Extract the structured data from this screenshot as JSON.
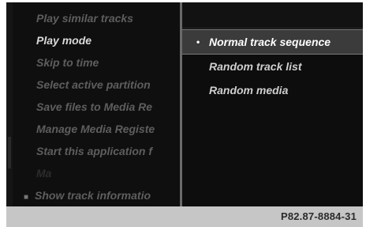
{
  "left_menu": {
    "items": [
      {
        "label": "Play similar tracks",
        "state": "normal"
      },
      {
        "label": "Play mode",
        "state": "active"
      },
      {
        "label": "Skip to time",
        "state": "normal"
      },
      {
        "label": "Select active partition",
        "state": "normal"
      },
      {
        "label": "Save files to Media Re",
        "state": "normal"
      },
      {
        "label": "Manage Media Registe",
        "state": "normal"
      },
      {
        "label": "Start this application f",
        "state": "normal"
      },
      {
        "label": "Ma",
        "state": "dim"
      },
      {
        "label": "Show track informatio",
        "state": "normal",
        "marker": "■"
      }
    ]
  },
  "play_mode_options": {
    "items": [
      {
        "label": "Normal track sequence",
        "selected": true,
        "bullet": "•"
      },
      {
        "label": "Random track list",
        "selected": false
      },
      {
        "label": "Random media",
        "selected": false
      }
    ]
  },
  "footer": {
    "code": "P82.87-8884-31"
  }
}
